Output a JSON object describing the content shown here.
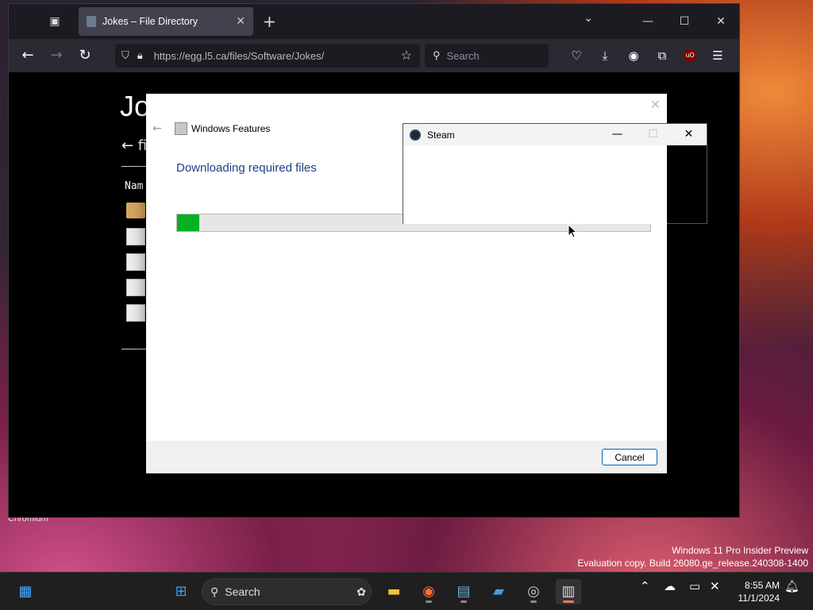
{
  "desktop": {
    "chromium_label": "Chromium",
    "watermark_line1": "Windows 11 Pro Insider Preview",
    "watermark_line2": "Evaluation copy. Build 26080.ge_release.240308-1400"
  },
  "browser": {
    "tab_title": "Jokes – File Directory",
    "url": "https://egg.l5.ca/files/Software/Jokes/",
    "search_placeholder": "Search",
    "page": {
      "heading": "Jok",
      "back_link": "← fi",
      "column_name": "Nam"
    }
  },
  "windows_features": {
    "title": "Windows Features",
    "heading": "Downloading required files",
    "progress_percent": 4.7,
    "cancel_label": "Cancel"
  },
  "steam": {
    "title": "Steam"
  },
  "taskbar": {
    "search_label": "Search",
    "time": "8:55 AM",
    "date": "11/1/2024"
  },
  "colors": {
    "progress_fill": "#06b025",
    "heading_blue": "#1e3d8c"
  }
}
